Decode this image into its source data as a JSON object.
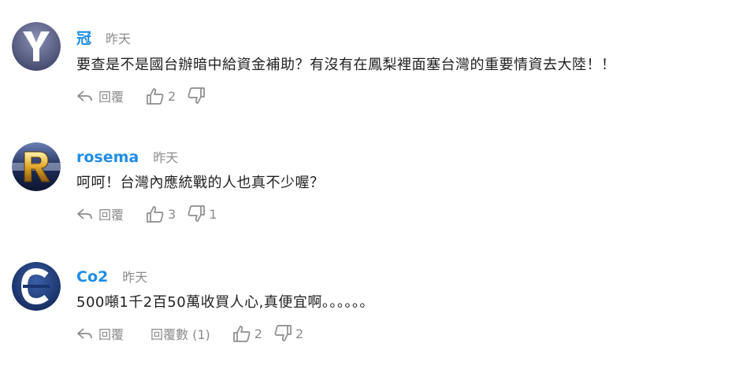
{
  "comments": [
    {
      "username": "冠",
      "time": "昨天",
      "text": "要查是不是國台辦暗中給資金補助？有沒有在鳳梨裡面塞台灣的重要情資去大陸！！",
      "reply_label": "回覆",
      "like_count": "2",
      "dislike_count": "",
      "avatar": {
        "letter": "Y",
        "bg": "#5a5f86"
      }
    },
    {
      "username": "rosema",
      "time": "昨天",
      "text": "呵呵！台灣內應統戰的人也真不少喔？",
      "reply_label": "回覆",
      "like_count": "3",
      "dislike_count": "1",
      "avatar": {
        "letter": "R",
        "bg": "#2b3d6e"
      }
    },
    {
      "username": "Co2",
      "time": "昨天",
      "text": "500噸1千2百50萬收買人心,真便宜啊。。。。。。",
      "reply_label": "回覆",
      "replies_label": "回覆數 (1)",
      "like_count": "2",
      "dislike_count": "2",
      "avatar": {
        "letter": "C",
        "bg": "#1f3a73"
      }
    }
  ],
  "colors": {
    "username": "#1e8de6",
    "muted": "#8c8c8c",
    "text": "#1f1f1f"
  }
}
